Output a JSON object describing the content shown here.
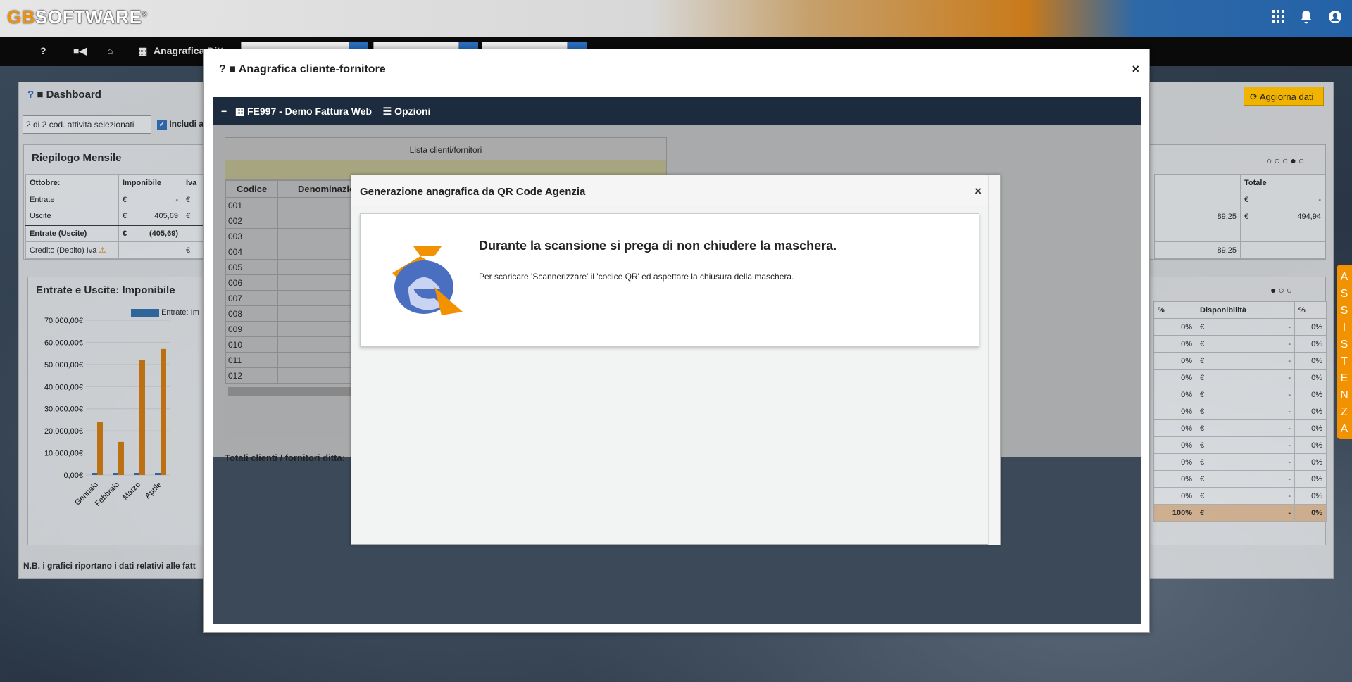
{
  "app": {
    "logo_prefix": "G",
    "logo_b": "B",
    "logo_rest": "SOFTWARE",
    "logo_reg": "®"
  },
  "topicons": {
    "apps": "grid-icon",
    "bell": "bell-icon",
    "user": "user-icon"
  },
  "navbar": {
    "help": "?",
    "home_label": "Anagrafica Ditt"
  },
  "dashboard": {
    "title": "Dashboard",
    "select_value": "2 di 2 cod. attività selezionati",
    "include_label": "Includi a",
    "aggiorna": "Aggiorna dati",
    "note": "N.B. i grafici riportano i dati relativi alle fatt"
  },
  "riepilogo": {
    "title": "Riepilogo Mensile",
    "headers": [
      "Ottobre:",
      "Imponibile",
      "Iva"
    ],
    "rows": [
      [
        "Entrate",
        "€",
        "-",
        "€"
      ],
      [
        "Uscite",
        "€",
        "405,69",
        "€"
      ],
      [
        "Entrate (Uscite)",
        "€",
        "(405,69)",
        ""
      ],
      [
        "Credito (Debito) Iva",
        "",
        "",
        "€"
      ]
    ],
    "right_header": "Totale",
    "right_rows": [
      [
        "",
        "€",
        "-"
      ],
      [
        "89,25",
        "€",
        "494,94"
      ],
      [
        "",
        ""
      ],
      [
        "89,25",
        ""
      ]
    ]
  },
  "imponibile": {
    "title": "Entrate e Uscite: Imponibile",
    "legend": "Entrate: Im",
    "y_ticks": [
      "70.000,00€",
      "60.000,00€",
      "50.000,00€",
      "40.000,00€",
      "30.000,00€",
      "20.000,00€",
      "10.000,00€",
      "0,00€"
    ],
    "right_headers": [
      "%",
      "Disponibilità",
      "%"
    ]
  },
  "chart_data": {
    "type": "bar",
    "categories": [
      "Gennaio",
      "Febbraio",
      "Marzo",
      "Aprile"
    ],
    "series": [
      {
        "name": "Entrate: Im",
        "values": [
          0,
          0,
          0,
          0
        ]
      },
      {
        "values": [
          24000,
          15000,
          52000,
          57000
        ]
      }
    ],
    "ylim": [
      0,
      70000
    ]
  },
  "right_table_rows": [
    [
      "0%",
      "€",
      "-",
      "0%"
    ],
    [
      "0%",
      "€",
      "-",
      "0%"
    ],
    [
      "0%",
      "€",
      "-",
      "0%"
    ],
    [
      "0%",
      "€",
      "-",
      "0%"
    ],
    [
      "0%",
      "€",
      "-",
      "0%"
    ],
    [
      "0%",
      "€",
      "-",
      "0%"
    ],
    [
      "0%",
      "€",
      "-",
      "0%"
    ],
    [
      "0%",
      "€",
      "-",
      "0%"
    ],
    [
      "0%",
      "€",
      "-",
      "0%"
    ],
    [
      "0%",
      "€",
      "-",
      "0%"
    ],
    [
      "0%",
      "€",
      "-",
      "0%"
    ],
    [
      "100%",
      "€",
      "-",
      "0%"
    ]
  ],
  "assistenza": [
    "A",
    "S",
    "S",
    "I",
    "S",
    "T",
    "E",
    "N",
    "Z",
    "A"
  ],
  "modal_anagrafica": {
    "help": "?",
    "title": "Anagrafica cliente-fornitore",
    "close": "×",
    "company": "FE997 - Demo Fattura Web",
    "options": "Opzioni",
    "lista_title": "Lista clienti/fornitori",
    "col_codice": "Codice",
    "col_denominazione": "Denominazio",
    "codes": [
      "001",
      "002",
      "003",
      "004",
      "005",
      "006",
      "007",
      "008",
      "009",
      "010",
      "011",
      "012"
    ],
    "totali": "Totali clienti / fornitori ditta:"
  },
  "modal_qr": {
    "title": "Generazione anagrafica da QR Code Agenzia",
    "close": "×",
    "heading": "Durante la scansione si prega di non chiudere la maschera.",
    "text": "Per scaricare 'Scannerizzare' il 'codice QR' ed aspettare la chiusura della maschera."
  }
}
